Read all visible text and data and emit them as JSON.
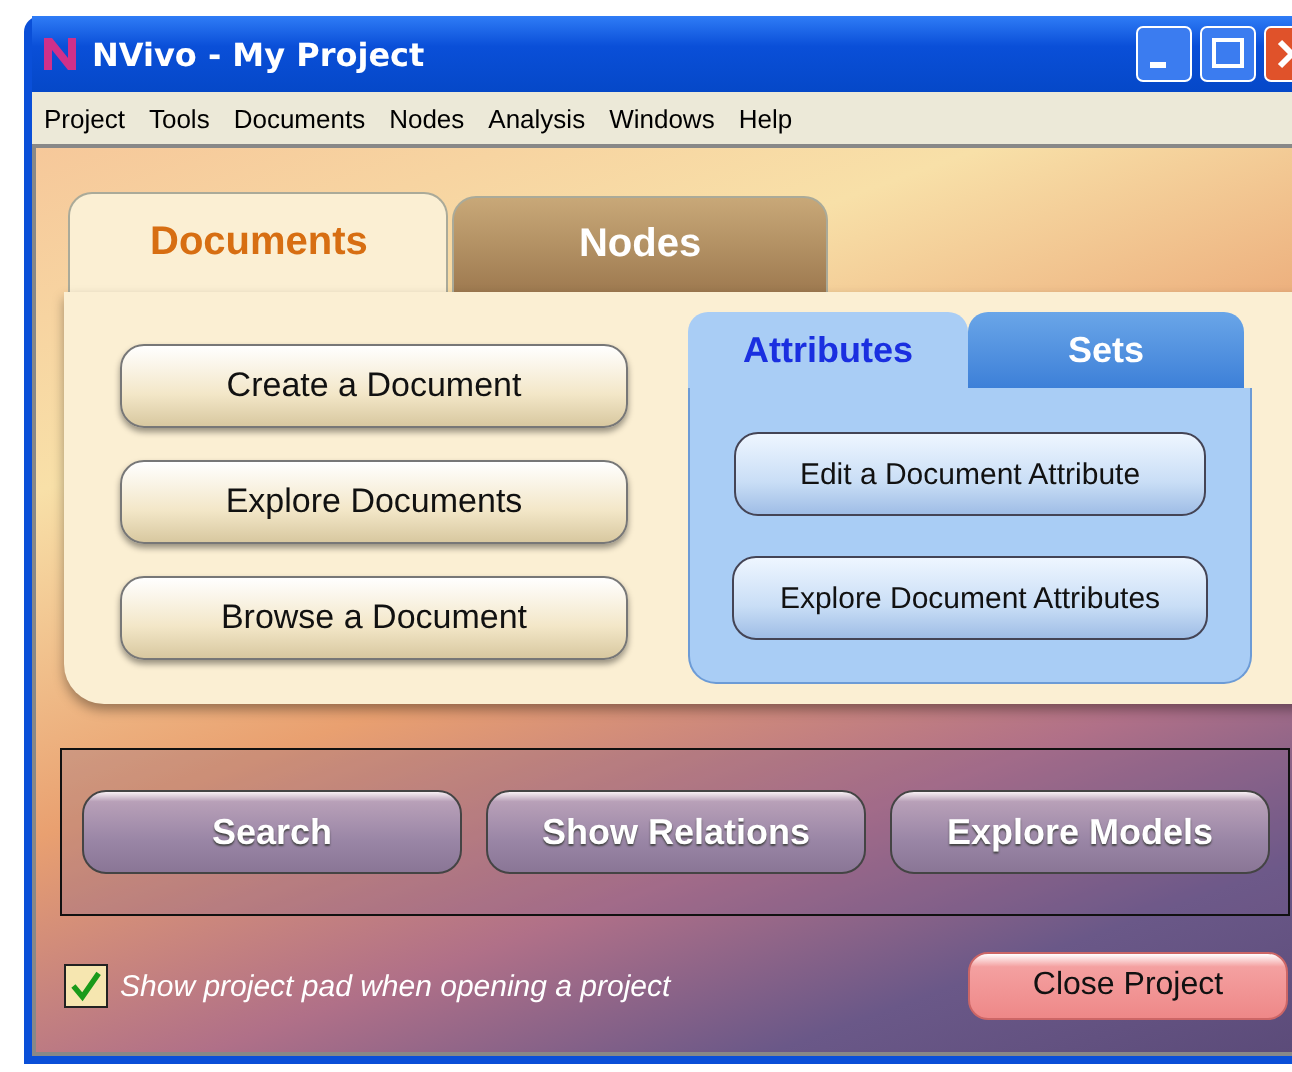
{
  "window": {
    "title": "NVivo - My Project"
  },
  "menu": [
    "Project",
    "Tools",
    "Documents",
    "Nodes",
    "Analysis",
    "Windows",
    "Help"
  ],
  "tabs": [
    {
      "label": "Documents",
      "selected": true
    },
    {
      "label": "Nodes",
      "selected": false
    }
  ],
  "document_actions": [
    "Create a Document",
    "Explore Documents",
    "Browse a Document"
  ],
  "sub_tabs": [
    {
      "label": "Attributes",
      "selected": true
    },
    {
      "label": "Sets",
      "selected": false
    }
  ],
  "attribute_actions": [
    "Edit a Document Attribute",
    "Explore Document Attributes"
  ],
  "tools": [
    "Search",
    "Show Relations",
    "Explore Models"
  ],
  "option": {
    "label": "Show project pad when opening a project",
    "checked": true
  },
  "close_button": "Close Project"
}
